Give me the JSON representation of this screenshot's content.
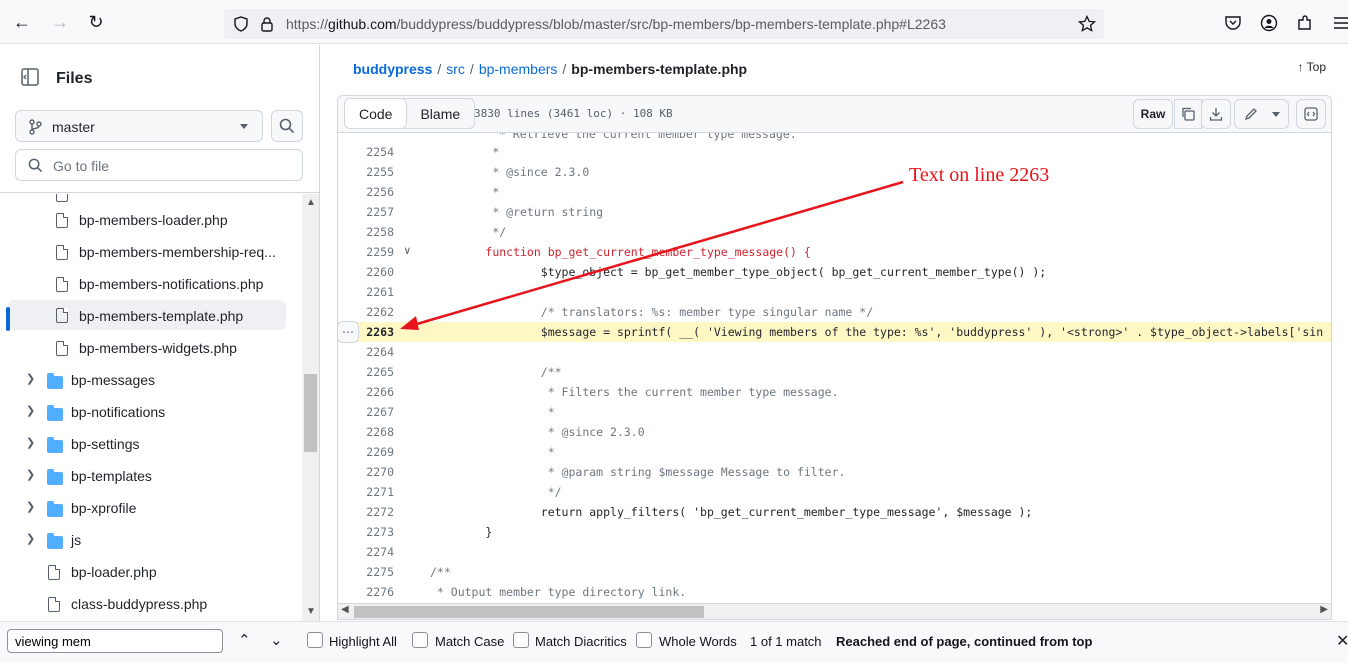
{
  "browser": {
    "url_prefix": "https://",
    "url_host": "github.com",
    "url_path": "/buddypress/buddypress/blob/master/src/bp-members/bp-members-template.php#L2263"
  },
  "sidebar": {
    "title": "Files",
    "branch": "master",
    "goto_placeholder": "Go to file",
    "items": [
      {
        "label": "bp-members-loader.php",
        "type": "file"
      },
      {
        "label": "bp-members-membership-req...",
        "type": "file"
      },
      {
        "label": "bp-members-notifications.php",
        "type": "file"
      },
      {
        "label": "bp-members-template.php",
        "type": "file",
        "active": true
      },
      {
        "label": "bp-members-widgets.php",
        "type": "file"
      },
      {
        "label": "bp-messages",
        "type": "folder"
      },
      {
        "label": "bp-notifications",
        "type": "folder"
      },
      {
        "label": "bp-settings",
        "type": "folder"
      },
      {
        "label": "bp-templates",
        "type": "folder"
      },
      {
        "label": "bp-xprofile",
        "type": "folder"
      },
      {
        "label": "js",
        "type": "folder"
      },
      {
        "label": "bp-loader.php",
        "type": "file"
      },
      {
        "label": "class-buddypress.php",
        "type": "file"
      }
    ]
  },
  "breadcrumb": {
    "repo": "buddypress",
    "p1": "src",
    "p2": "bp-members",
    "file": "bp-members-template.php",
    "sep": "/",
    "top": "Top"
  },
  "file_header": {
    "code_tab": "Code",
    "blame_tab": "Blame",
    "meta": "3830 lines (3461 loc) · 108 KB",
    "raw": "Raw"
  },
  "code_lines": [
    {
      "n": "2254",
      "t": "\t *"
    },
    {
      "n": "2255",
      "t": "\t * @since 2.3.0"
    },
    {
      "n": "2256",
      "t": "\t *"
    },
    {
      "n": "2257",
      "t": "\t * @return string"
    },
    {
      "n": "2258",
      "t": "\t */"
    },
    {
      "n": "2259",
      "t": "\tfunction bp_get_current_member_type_message() {"
    },
    {
      "n": "2260",
      "t": "\t\t$type_object = bp_get_member_type_object( bp_get_current_member_type() );"
    },
    {
      "n": "2261",
      "t": ""
    },
    {
      "n": "2262",
      "t": "\t\t/* translators: %s: member type singular name */"
    },
    {
      "n": "2263",
      "t": "\t\t$message = sprintf( __( 'Viewing members of the type: %s', 'buddypress' ), '<strong>' . $type_object->labels['sin"
    },
    {
      "n": "2264",
      "t": ""
    },
    {
      "n": "2265",
      "t": "\t\t/**"
    },
    {
      "n": "2266",
      "t": "\t\t * Filters the current member type message."
    },
    {
      "n": "2267",
      "t": "\t\t *"
    },
    {
      "n": "2268",
      "t": "\t\t * @since 2.3.0"
    },
    {
      "n": "2269",
      "t": "\t\t *"
    },
    {
      "n": "2270",
      "t": "\t\t * @param string $message Message to filter."
    },
    {
      "n": "2271",
      "t": "\t\t */"
    },
    {
      "n": "2272",
      "t": "\t\treturn apply_filters( 'bp_get_current_member_type_message', $message );"
    },
    {
      "n": "2273",
      "t": "\t}"
    },
    {
      "n": "2274",
      "t": ""
    },
    {
      "n": "2275",
      "t": "/**"
    },
    {
      "n": "2276",
      "t": " * Output member type directory link."
    }
  ],
  "annotation": "Text on line 2263",
  "findbar": {
    "query": "viewing mem",
    "highlight_all": "Highlight All",
    "match_case": "Match Case",
    "match_diacritics": "Match Diacritics",
    "whole_words": "Whole Words",
    "match_count": "1 of 1 match",
    "status": "Reached end of page, continued from top"
  }
}
